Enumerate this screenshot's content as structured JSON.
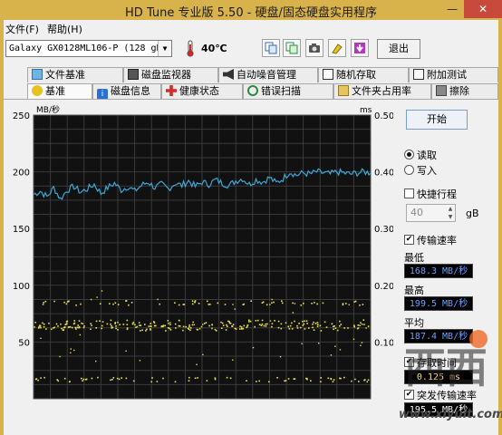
{
  "window": {
    "title": "HD Tune 专业版 5.50 - 硬盘/固态硬盘实用程序",
    "minimize_glyph": "—",
    "close_glyph": "✕"
  },
  "menu": {
    "file": "文件(F)",
    "help": "帮助(H)"
  },
  "toolbar": {
    "drive": "Galaxy GX0128ML106-P (128 gB)",
    "temperature": "40℃",
    "exit_label": "退出",
    "icons": [
      "copy-info-icon",
      "copy-screen-icon",
      "camera-icon",
      "options-icon",
      "save-download-icon"
    ]
  },
  "tabs": {
    "row1": [
      "文件基准",
      "磁盘监视器",
      "自动噪音管理",
      "随机存取",
      "附加测试"
    ],
    "row2": [
      "基准",
      "磁盘信息",
      "健康状态",
      "错误扫描",
      "文件夹占用率",
      "擦除"
    ],
    "active": "基准"
  },
  "chart_data": {
    "type": "line",
    "ylabel_left": "MB/秒",
    "ylabel_right": "ms",
    "y_left_ticks": [
      "250",
      "200",
      "150",
      "100",
      "50"
    ],
    "y_right_ticks": [
      "0.50",
      "0.40",
      "0.30",
      "0.20",
      "0.10"
    ],
    "ylim_left": [
      0,
      250
    ],
    "ylim_right": [
      0,
      0.5
    ],
    "grid": true,
    "series": [
      {
        "name": "传输速率",
        "color": "#3aa8d8",
        "x": [
          0,
          2,
          4,
          6,
          8,
          10,
          12,
          14,
          16,
          18,
          20,
          22,
          24,
          26,
          28,
          30,
          32,
          34,
          36,
          38,
          40,
          42,
          44,
          46,
          48,
          50,
          52,
          54,
          56,
          58,
          60,
          62,
          64,
          66,
          68,
          70,
          72,
          74,
          76,
          78,
          80,
          82,
          84,
          86,
          88,
          90,
          92,
          94,
          96,
          98,
          100
        ],
        "values": [
          180,
          183,
          178,
          186,
          176,
          184,
          187,
          182,
          185,
          189,
          181,
          186,
          190,
          184,
          187,
          183,
          188,
          191,
          186,
          189,
          185,
          190,
          188,
          192,
          187,
          191,
          189,
          193,
          190,
          188,
          192,
          194,
          189,
          193,
          191,
          195,
          190,
          194,
          200,
          197,
          199,
          198,
          200,
          199,
          198,
          200,
          199,
          198,
          199,
          200,
          199
        ]
      },
      {
        "name": "存取时间",
        "color": "#e8e04a",
        "marker": "dots",
        "bands_ms": [
          0.125,
          0.128,
          0.132,
          0.136,
          0.17,
          0.035
        ],
        "outlier_range_ms": [
          0.06,
          0.2
        ]
      }
    ]
  },
  "side": {
    "start_label": "开始",
    "read_label": "读取",
    "write_label": "写入",
    "short_stroke_label": "快捷行程",
    "short_stroke_value": "40",
    "short_stroke_unit": "gB",
    "transfer_rate_label": "传输速率",
    "min_label": "最低",
    "min_value": "168.3 MB/秒",
    "max_label": "最高",
    "max_value": "199.5 MB/秒",
    "avg_label": "平均",
    "avg_value": "187.4 MB/秒",
    "access_time_label": "存取时间",
    "access_time_value": "0.125 ms",
    "burst_rate_label": "突发传输速率",
    "burst_rate_value": "195.5 MB/秒"
  },
  "watermark": {
    "logo_text": "西西",
    "url": "www.xiyuit.com"
  }
}
